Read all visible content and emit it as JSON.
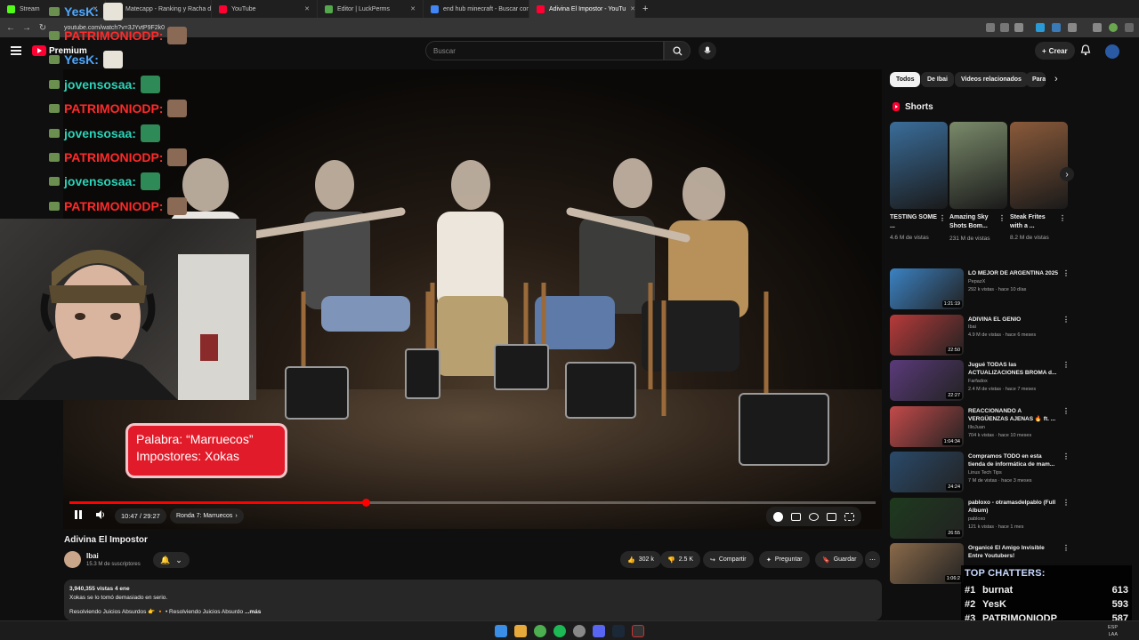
{
  "browser": {
    "tabs": [
      {
        "label": "Stream",
        "color": "#53fc18"
      },
      {
        "label": "Matecapp - Ranking y Racha d",
        "color": "#ff8c2a"
      },
      {
        "label": "YouTube",
        "color": "#ff0033"
      },
      {
        "label": "Editor | LuckPerms",
        "color": "#54a84c"
      },
      {
        "label": "end hub minecraft - Buscar con",
        "color": "#4285f4"
      },
      {
        "label": "Adivina El Impostor - YouTu",
        "color": "#ff0033"
      }
    ],
    "new_tab_label": "+",
    "url": "youtube.com/watch?v=3JYvtP9F2k0"
  },
  "header": {
    "logo_text": "Premium",
    "logo_region": "AR",
    "search_placeholder": "Buscar",
    "create_label": "Crear"
  },
  "player": {
    "caption_line1": "Palabra: “Marruecos”",
    "caption_line2": "Impostores: Xokas",
    "time": "10:47 / 29:27",
    "chapter": "Ronda 7: Marruecos",
    "progress": 0.368
  },
  "video": {
    "title": "Adivina El Impostor",
    "channel": "Ibai",
    "subscribers": "15.3 M de suscriptores",
    "likes": "302 k",
    "dislikes": "2.5 K",
    "share": "Compartir",
    "ask": "Preguntar",
    "save": "Guardar",
    "desc_stats": "3,940,355 vistas  4 ene",
    "desc_line1": "Xokas se lo tomó demasiado en serio.",
    "desc_line2": "Resolviendo Juicios Absurdos 👉 🔸 • Resolviendo Juicios Absurdo",
    "desc_more": "...más"
  },
  "filters": [
    "Todos",
    "De Ibai",
    "Videos relacionados",
    "Para"
  ],
  "shorts": {
    "header": "Shorts",
    "items": [
      {
        "title": "TESTING SOME ...",
        "views": "4.6 M de vistas",
        "color": "#3a6d9a"
      },
      {
        "title": "Amazing Sky Shots Bom...",
        "views": "231 M de vistas",
        "color": "#7a8a6a"
      },
      {
        "title": "Steak Frites with a ...",
        "views": "8.2 M de vistas",
        "color": "#8a5a3a"
      }
    ]
  },
  "recommendations": [
    {
      "title": "LO MEJOR DE ARGENTINA 2025",
      "channel": "PepazX",
      "meta": "292 k vistas · hace 10 días",
      "duration": "1:21:19",
      "color": "#3b82c4"
    },
    {
      "title": "ADIVINA EL GENIO",
      "channel": "Ibai",
      "meta": "4.9 M de vistas · hace 6 meses",
      "duration": "22:50",
      "color": "#b83a3a"
    },
    {
      "title": "Jugué TODAS las ACTUALIZACIONES BROMA d...",
      "channel": "Farfadox",
      "meta": "2.4 M de vistas · hace 7 meses",
      "duration": "22:27",
      "color": "#5a3a7a"
    },
    {
      "title": "REACCIONANDO A VERGÜENZAS AJENAS 🔥 ft. ...",
      "channel": "IlloJuan",
      "meta": "704 k vistas · hace 10 meses",
      "duration": "1:04:34",
      "color": "#c44a4a"
    },
    {
      "title": "Compramos TODO en esta tienda de informática de mam...",
      "channel": "Linus Tech Tips",
      "meta": "7 M de vistas · hace 3 meses",
      "duration": "24:24",
      "color": "#2a4a6a"
    },
    {
      "title": "pabloxo - otramasdelpablo (Full Album)",
      "channel": "pabloxo",
      "meta": "121 k vistas · hace 1 mes",
      "duration": "26:55",
      "color": "#1e3a1e"
    },
    {
      "title": "Organicé El Amigo Invisible Entre Youtubers!",
      "channel": "",
      "meta": "",
      "duration": "1:06:2",
      "color": "#8a6a4a"
    }
  ],
  "stream": {
    "chat": [
      {
        "user": "YesK:",
        "color": "#4fa8ff"
      },
      {
        "user": "PATRIMONIODP:",
        "color": "#ff2a2a"
      },
      {
        "user": "YesK:",
        "color": "#4fa8ff"
      },
      {
        "user": "jovensosaa:",
        "color": "#2ad4b8"
      },
      {
        "user": "PATRIMONIODP:",
        "color": "#ff2a2a"
      },
      {
        "user": "jovensosaa:",
        "color": "#2ad4b8"
      },
      {
        "user": "PATRIMONIODP:",
        "color": "#ff2a2a"
      },
      {
        "user": "jovensosaa:",
        "color": "#2ad4b8"
      },
      {
        "user": "PATRIMONIODP:",
        "color": "#ff2a2a"
      }
    ],
    "top_chatters_title": "TOP CHATTERS:",
    "top_chatters": [
      {
        "rank": "#1",
        "name": "burnat",
        "count": "613"
      },
      {
        "rank": "#2",
        "name": "YesK",
        "count": "593"
      },
      {
        "rank": "#3",
        "name": "PATRIMONIODP",
        "count": "587"
      }
    ]
  },
  "taskbar": {
    "clock_lines": [
      "ESP",
      "LAA"
    ]
  }
}
